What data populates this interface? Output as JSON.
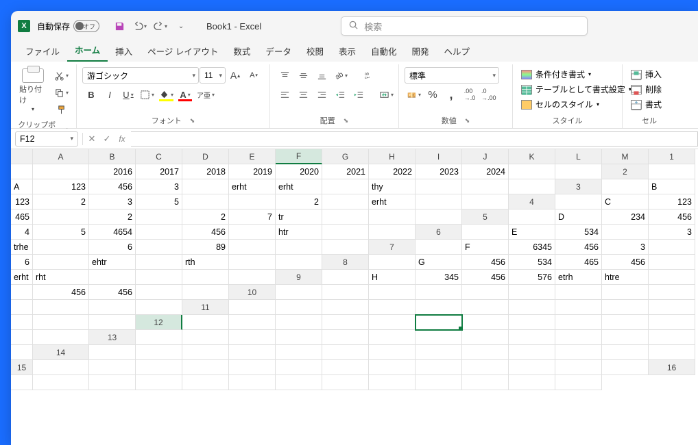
{
  "titlebar": {
    "autosave_label": "自動保存",
    "autosave_state": "オフ",
    "doc_title": "Book1 - Excel",
    "search_placeholder": "検索"
  },
  "tabs": [
    "ファイル",
    "ホーム",
    "挿入",
    "ページ レイアウト",
    "数式",
    "データ",
    "校閲",
    "表示",
    "自動化",
    "開発",
    "ヘルプ"
  ],
  "active_tab": "ホーム",
  "ribbon": {
    "clipboard": {
      "label": "クリップボード",
      "paste": "貼り付け"
    },
    "font": {
      "label": "フォント",
      "name": "游ゴシック",
      "size": "11"
    },
    "alignment": {
      "label": "配置"
    },
    "number": {
      "label": "数値",
      "format": "標準"
    },
    "styles": {
      "label": "スタイル",
      "conditional": "条件付き書式",
      "table": "テーブルとして書式設定",
      "cell": "セルのスタイル"
    },
    "cells": {
      "label": "セル",
      "insert": "挿入",
      "delete": "削除",
      "format": "書式"
    }
  },
  "namebox": "F12",
  "columns": [
    "A",
    "B",
    "C",
    "D",
    "E",
    "F",
    "G",
    "H",
    "I",
    "J",
    "K",
    "L",
    "M"
  ],
  "rows_count": 16,
  "selected_cell": {
    "row": 12,
    "col": "F"
  },
  "data": {
    "1": {
      "C": "2016",
      "D": "2017",
      "E": "2018",
      "F": "2019",
      "G": "2020",
      "H": "2021",
      "I": "2022",
      "J": "2023",
      "K": "2024"
    },
    "2": {
      "B": "A",
      "C": "123",
      "D": "456",
      "E": "3",
      "G": "erht",
      "H": "erht",
      "J": "thy"
    },
    "3": {
      "B": "B",
      "C": "123",
      "D": "2",
      "E": "3",
      "F": "5",
      "I": "2",
      "K": "erht"
    },
    "4": {
      "B": "C",
      "C": "123",
      "D": "465",
      "F": "2",
      "H": "2",
      "I": "7",
      "J": "tr"
    },
    "5": {
      "B": "D",
      "C": "234",
      "D": "456",
      "E": "4",
      "F": "5",
      "G": "4654",
      "I": "456",
      "K": "htr"
    },
    "6": {
      "B": "E",
      "C": "534",
      "E": "3",
      "F": "trhe",
      "H": "6",
      "J": "89"
    },
    "7": {
      "B": "F",
      "C": "6345",
      "D": "456",
      "E": "3",
      "G": "6",
      "I": "ehtr",
      "K": "rth"
    },
    "8": {
      "B": "G",
      "C": "456",
      "D": "534",
      "E": "465",
      "F": "456",
      "H": "erht",
      "I": "rht"
    },
    "9": {
      "B": "H",
      "C": "345",
      "D": "456",
      "E": "576",
      "F": "etrh",
      "G": "htre",
      "J": "456",
      "K": "456"
    }
  },
  "text_cells": [
    "2.G",
    "2.H",
    "2.J",
    "3.K",
    "4.J",
    "5.K",
    "6.F",
    "7.I",
    "7.K",
    "8.H",
    "8.I",
    "9.F",
    "9.G",
    "2.B",
    "3.B",
    "4.B",
    "5.B",
    "6.B",
    "7.B",
    "8.B",
    "9.B"
  ]
}
